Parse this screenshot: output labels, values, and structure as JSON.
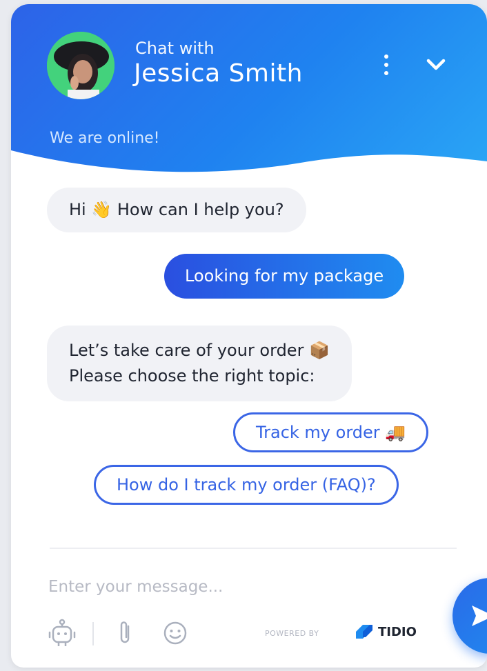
{
  "header": {
    "subtitle": "Chat with",
    "agent_name": "Jessica Smith",
    "status": "We are online!"
  },
  "messages": [
    {
      "from": "agent",
      "text": "Hi 👋 How can I help you?"
    },
    {
      "from": "user",
      "text": "Looking for my package"
    },
    {
      "from": "agent",
      "lines": [
        "Let’s take care of your order 📦",
        "Please choose the right topic:"
      ]
    }
  ],
  "options": [
    {
      "label": "Track my order 🚚"
    },
    {
      "label": "How do I track my order (FAQ)?"
    }
  ],
  "composer": {
    "placeholder": "Enter your message..."
  },
  "footer": {
    "powered_by": "POWERED BY",
    "brand": "TIDIO"
  },
  "colors": {
    "header_gradient_start": "#2d63e8",
    "header_gradient_end": "#2aa6f5",
    "accent": "#3563e4",
    "agent_bubble": "#f1f2f6"
  },
  "icons": {
    "menu": "more-vertical-icon",
    "collapse": "chevron-down-icon",
    "bot": "bot-icon",
    "attach": "paperclip-icon",
    "emoji": "emoji-icon",
    "send": "send-icon",
    "brand": "tidio-logo-icon"
  }
}
